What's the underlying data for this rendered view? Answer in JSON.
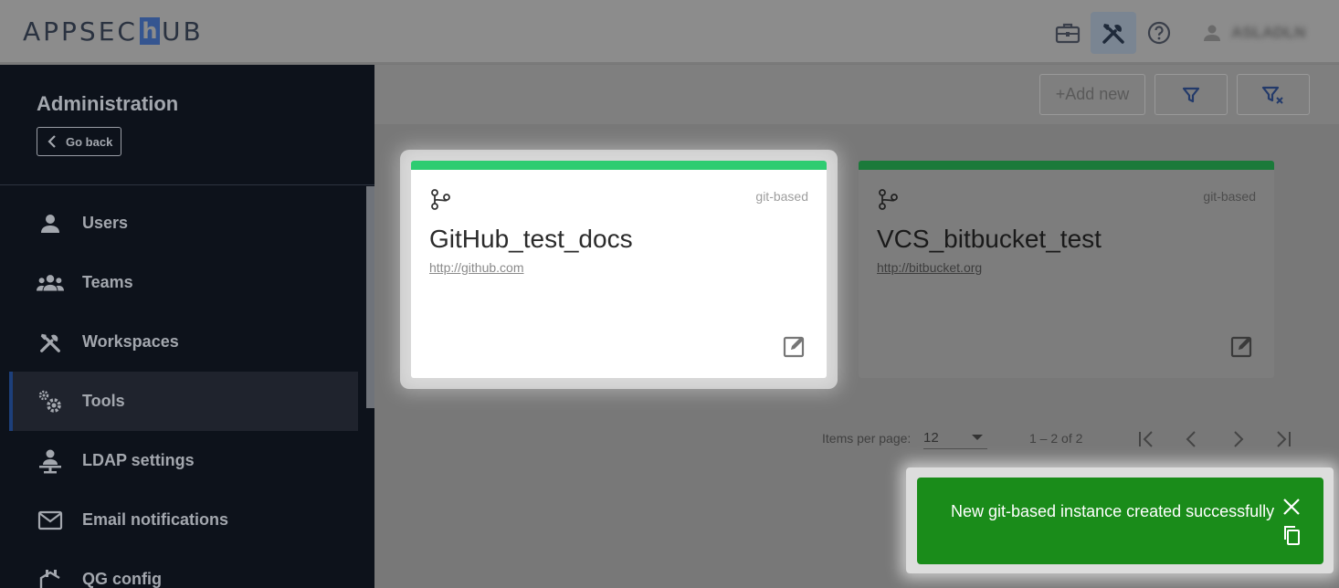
{
  "header": {
    "logo_text_left": "APPSEC",
    "logo_text_h": "h",
    "logo_text_right": "UB",
    "icons": [
      "briefcase-icon",
      "tools-icon",
      "help-icon",
      "user-icon"
    ],
    "username": "ASLADLN"
  },
  "sidebar": {
    "title": "Administration",
    "go_back": "Go back",
    "items": [
      {
        "label": "Users",
        "icon": "user-icon"
      },
      {
        "label": "Teams",
        "icon": "teams-icon"
      },
      {
        "label": "Workspaces",
        "icon": "workspaces-icon"
      },
      {
        "label": "Tools",
        "icon": "tools-gear-icon",
        "active": true
      },
      {
        "label": "LDAP settings",
        "icon": "ldap-icon"
      },
      {
        "label": "Email notifications",
        "icon": "email-icon"
      },
      {
        "label": "QG config",
        "icon": "qg-config-icon"
      }
    ]
  },
  "toolbar": {
    "add_new": "+Add new",
    "filter_icon": "filter-icon",
    "clear_filter_icon": "clear-filter-icon"
  },
  "cards": [
    {
      "type": "git-based",
      "name": "GitHub_test_docs",
      "url": "http://github.com",
      "icon": "git-branch-icon",
      "bar_color": "#2ecc71"
    },
    {
      "type": "git-based",
      "name": "VCS_bitbucket_test",
      "url": "http://bitbucket.org",
      "icon": "git-branch-icon",
      "bar_color": "#1b7a3a"
    }
  ],
  "paginator": {
    "items_per_page_label": "Items per page:",
    "items_per_page_value": "12",
    "range_label": "1 – 2 of 2"
  },
  "toast": {
    "message": "New git-based instance created successfully",
    "color": "#1a8c1a"
  }
}
